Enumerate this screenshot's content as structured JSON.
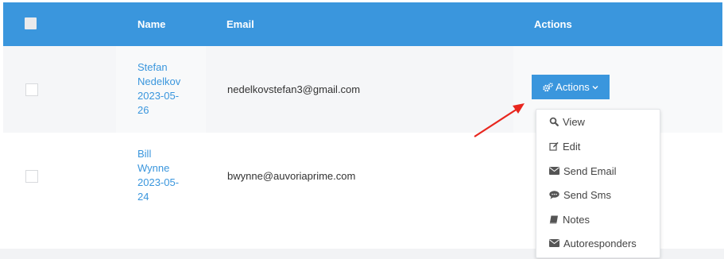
{
  "table": {
    "headers": {
      "name": "Name",
      "email": "Email",
      "actions": "Actions"
    },
    "rows": [
      {
        "name_lines": [
          "Stefan",
          "Nedelkov",
          "2023-05-",
          "26"
        ],
        "email": "nedelkovstefan3@gmail.com"
      },
      {
        "name_lines": [
          "Bill",
          "Wynne",
          "2023-05-",
          "24"
        ],
        "email": "bwynne@auvoriaprime.com"
      }
    ]
  },
  "actions_button": {
    "label": "Actions",
    "icon": "gears-icon",
    "caret_icon": "chevron-down-icon"
  },
  "dropdown": {
    "items": [
      {
        "label": "View",
        "icon": "search-icon"
      },
      {
        "label": "Edit",
        "icon": "edit-icon"
      },
      {
        "label": "Send Email",
        "icon": "envelope-icon"
      },
      {
        "label": "Send Sms",
        "icon": "comment-icon"
      },
      {
        "label": "Notes",
        "icon": "book-icon"
      },
      {
        "label": "Autoresponders",
        "icon": "envelope-icon"
      }
    ]
  },
  "colors": {
    "header_bg": "#3a96dd",
    "link": "#3a96dd",
    "annotation_arrow": "#e8261e"
  }
}
